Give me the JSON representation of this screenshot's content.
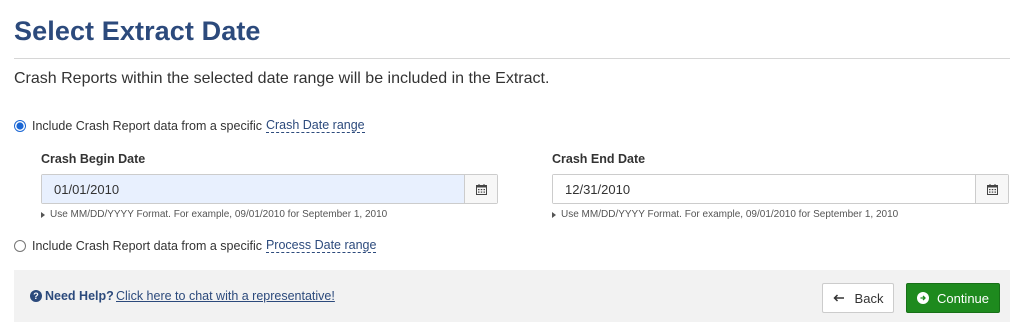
{
  "page": {
    "title": "Select Extract Date",
    "description": "Crash Reports within the selected date range will be included in the Extract."
  },
  "options": {
    "crash_prefix": "Include Crash Report data from a specific",
    "crash_link": "Crash Date range",
    "crash_selected": true,
    "process_prefix": "Include Crash Report data from a specific",
    "process_link": "Process Date range",
    "process_selected": false
  },
  "begin": {
    "label": "Crash Begin Date",
    "value": "01/01/2010",
    "hint": "Use MM/DD/YYYY Format. For example, 09/01/2010 for September 1, 2010"
  },
  "end": {
    "label": "Crash End Date",
    "value": "12/31/2010",
    "hint": "Use MM/DD/YYYY Format. For example, 09/01/2010 for September 1, 2010"
  },
  "footer": {
    "help_label": "Need Help?",
    "help_link": "Click here to chat with a representative!",
    "back_label": "Back",
    "continue_label": "Continue"
  },
  "icons": {
    "help": "question-circle-icon",
    "calendar": "calendar-icon",
    "back": "arrow-left-icon",
    "continue": "arrow-circle-right-icon"
  },
  "colors": {
    "title": "#2c4a7c",
    "link": "#2c4a7c",
    "continue_button": "#1e8a1e",
    "active_input": "#e8f0fe",
    "footer_background": "#f2f2f2"
  }
}
